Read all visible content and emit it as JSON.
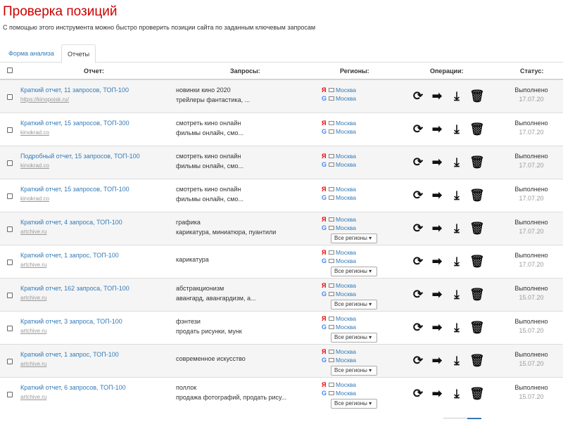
{
  "page": {
    "title": "Проверка позиций",
    "subtitle": "С помощью этого инструмента можно быстро проверить позиции сайта по заданным ключевым запросам"
  },
  "tabs": [
    {
      "label": "Форма анализа"
    },
    {
      "label": "Отчеты"
    }
  ],
  "columns": {
    "report": "Отчет:",
    "queries": "Запросы:",
    "regions": "Регионы:",
    "operations": "Операции:",
    "status": "Статус:"
  },
  "icons": {
    "refresh": "refresh-icon",
    "export": "export-icon",
    "download": "download-icon",
    "delete": "trash-icon"
  },
  "colors": {
    "title": "#cc0000",
    "link": "#337ab7",
    "yandex": "#ee0000",
    "google": "#4285f4"
  },
  "rows": [
    {
      "title": "Краткий отчет, 11 запросов, ТОП-100",
      "site": "https://kinopoisk.ru/",
      "q1": "новинки кино 2020",
      "q2": "трейлеры фантастика, ...",
      "r1": "Москва",
      "r2": "Москва",
      "select": "",
      "status": "Выполнено",
      "date": "17.07.20"
    },
    {
      "title": "Краткий отчет, 15 запросов, ТОП-300",
      "site": "kinokrad.co",
      "q1": "смотреть кино онлайн",
      "q2": "фильмы онлайн, смо...",
      "r1": "Москва",
      "r2": "Москва",
      "select": "",
      "status": "Выполнено",
      "date": "17.07.20"
    },
    {
      "title": "Подробный отчет, 15 запросов, ТОП-100",
      "site": "kinokrad.co",
      "q1": "смотреть кино онлайн",
      "q2": "фильмы онлайн, смо...",
      "r1": "Москва",
      "r2": "Москва",
      "select": "",
      "status": "Выполнено",
      "date": "17.07.20"
    },
    {
      "title": "Краткий отчет, 15 запросов, ТОП-100",
      "site": "kinokrad.co",
      "q1": "смотреть кино онлайн",
      "q2": "фильмы онлайн, смо...",
      "r1": "Москва",
      "r2": "Москва",
      "select": "",
      "status": "Выполнено",
      "date": "17.07.20"
    },
    {
      "title": "Краткий отчет, 4 запроса, ТОП-100",
      "site": "artchive.ru",
      "q1": "графика",
      "q2": "карикатура, миниатюра, пуантили",
      "r1": "Москва",
      "r2": "Москва",
      "select": "Все регионы",
      "status": "Выполнено",
      "date": "17.07.20"
    },
    {
      "title": "Краткий отчет, 1 запрос, ТОП-100",
      "site": "artchive.ru",
      "q1": "карикатура",
      "q2": "",
      "r1": "Москва",
      "r2": "Москва",
      "select": "Все регионы",
      "status": "Выполнено",
      "date": "17.07.20"
    },
    {
      "title": "Краткий отчет, 162 запроса, ТОП-100",
      "site": "artchive.ru",
      "q1": "абстракционизм",
      "q2": "авангард, авангардизм, а...",
      "r1": "Москва",
      "r2": "Москва",
      "select": "Все регионы",
      "status": "Выполнено",
      "date": "15.07.20"
    },
    {
      "title": "Краткий отчет, 3 запроса, ТОП-100",
      "site": "artchive.ru",
      "q1": "фэнтези",
      "q2": "продать рисунки, мунк",
      "r1": "Москва",
      "r2": "Москва",
      "select": "Все регионы",
      "status": "Выполнено",
      "date": "15.07.20"
    },
    {
      "title": "Краткий отчет, 1 запрос, ТОП-100",
      "site": "artchive.ru",
      "q1": "современное искусство",
      "q2": "",
      "r1": "Москва",
      "r2": "Москва",
      "select": "Все регионы",
      "status": "Выполнено",
      "date": "15.07.20"
    },
    {
      "title": "Краткий отчет, 6 запросов, ТОП-100",
      "site": "artchive.ru",
      "q1": "поллок",
      "q2": "продажа фотографий, продать рису...",
      "r1": "Москва",
      "r2": "Москва",
      "select": "Все регионы",
      "status": "Выполнено",
      "date": "15.07.20"
    }
  ]
}
